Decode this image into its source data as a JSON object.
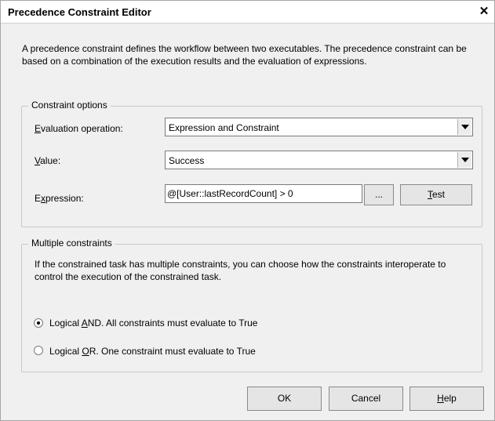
{
  "window": {
    "title": "Precedence Constraint Editor",
    "close_glyph": "✕"
  },
  "description": "A precedence constraint defines the workflow between two executables. The precedence constraint can be based on a combination of the execution results and the evaluation of expressions.",
  "constraint_options": {
    "legend": "Constraint options",
    "evaluation_label_first": "E",
    "evaluation_label_rest": "valuation operation:",
    "evaluation_value": "Expression and Constraint",
    "value_label_first": "V",
    "value_label_rest": "alue:",
    "value_value": "Success",
    "expression_label_pre": "E",
    "expression_label_u": "x",
    "expression_label_post": "pression:",
    "expression_value": "@[User::lastRecordCount] > 0",
    "ellipsis_label": "...",
    "test_label_first": "T",
    "test_label_rest": "est"
  },
  "multiple_constraints": {
    "legend": "Multiple constraints",
    "description": "If the constrained task has multiple constraints, you can choose how the constraints interoperate to control the execution of the constrained task.",
    "and_pre": "Logical ",
    "and_u": "A",
    "and_post": "ND. All constraints must evaluate to True",
    "or_pre": "Logical ",
    "or_u": "O",
    "or_post": "R. One constraint must evaluate to True",
    "selected": "and"
  },
  "buttons": {
    "ok": "OK",
    "cancel": "Cancel",
    "help_first": "H",
    "help_rest": "elp"
  }
}
